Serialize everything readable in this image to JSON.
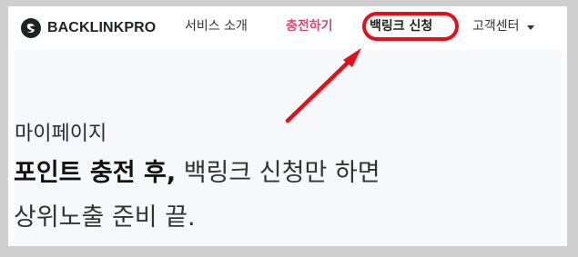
{
  "brand": {
    "name": "BACKLINKPRO",
    "logo_icon": "backlinkpro-logo-icon"
  },
  "nav": {
    "items": [
      {
        "label": "서비스 소개"
      },
      {
        "label": "충전하기"
      },
      {
        "label": "백링크 신청"
      },
      {
        "label": "고객센터"
      }
    ],
    "dropdown_icon": "chevron-down-icon"
  },
  "colors": {
    "accent": "#d9486f",
    "highlight": "#e50f16",
    "hero_background": "#f7f8fb",
    "text": "#222222"
  },
  "hero": {
    "subtitle": "마이페이지",
    "headline_bold": "포인트 충전 후,",
    "headline_normal": "백링크 신청만 하면",
    "headline_line2": "상위노출 준비 끝."
  }
}
